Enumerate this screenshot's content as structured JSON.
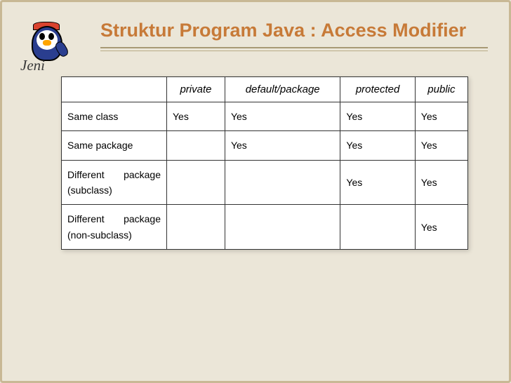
{
  "logo": {
    "text": "Jeni"
  },
  "title": "Struktur Program Java : Access Modifier",
  "chart_data": {
    "type": "table",
    "columns": [
      "",
      "private",
      "default/package",
      "protected",
      "public"
    ],
    "rows": [
      {
        "label": "Same class",
        "values": [
          "Yes",
          "Yes",
          "Yes",
          "Yes"
        ]
      },
      {
        "label": "Same package",
        "values": [
          "",
          "Yes",
          "Yes",
          "Yes"
        ]
      },
      {
        "label": "Different package (subclass)",
        "values": [
          "",
          "",
          "Yes",
          "Yes"
        ]
      },
      {
        "label": "Different package (non-subclass)",
        "values": [
          "",
          "",
          "",
          "Yes"
        ]
      }
    ]
  }
}
